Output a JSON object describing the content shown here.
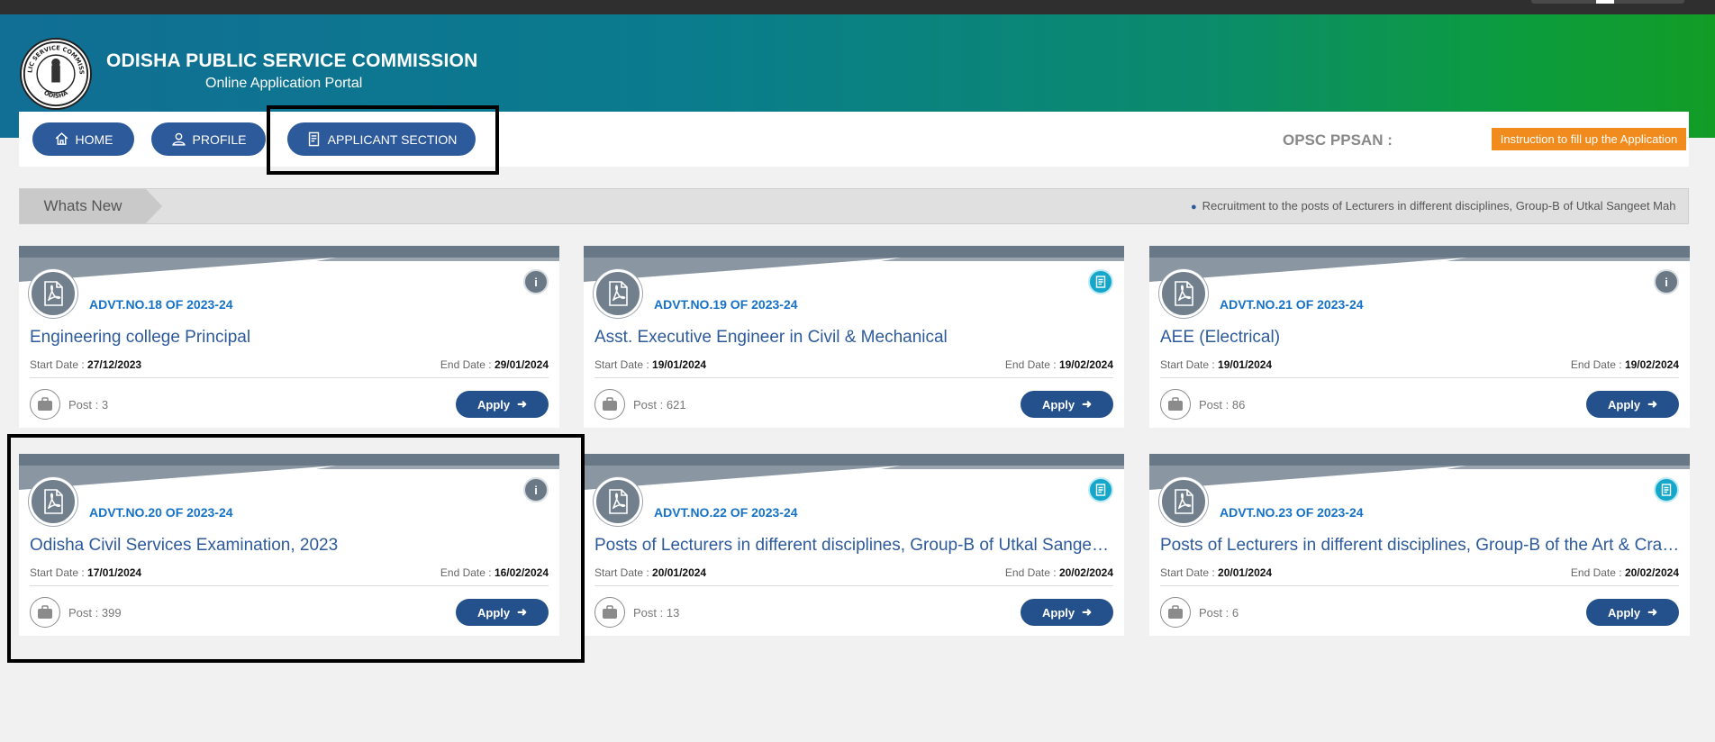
{
  "header": {
    "org_title": "ODISHA PUBLIC SERVICE COMMISSION",
    "org_subtitle": "Online Application Portal",
    "logo_text_top": "PUBLIC SERVICE COMMISSION",
    "logo_text_bottom": "ODISHA"
  },
  "nav": {
    "home": "HOME",
    "profile": "PROFILE",
    "applicant": "APPLICANT SECTION",
    "ppsan_label": "OPSC PPSAN :",
    "instruction_button": "Instruction to fill up the Application"
  },
  "whats_new": {
    "label": "Whats New",
    "ticker": "Recruitment to the posts of Lecturers in different disciplines, Group-B of Utkal Sangeet Mah"
  },
  "card_labels": {
    "start": "Start Date :",
    "end": "End Date :",
    "post": "Post :",
    "apply": "Apply"
  },
  "cards": [
    {
      "advt": "ADVT.NO.18 OF 2023-24",
      "title": "Engineering college Principal",
      "start": "27/12/2023",
      "end": "29/01/2024",
      "posts": "3",
      "icon": "info-icon"
    },
    {
      "advt": "ADVT.NO.19 OF 2023-24",
      "title": "Asst. Executive Engineer in Civil & Mechanical",
      "start": "19/01/2024",
      "end": "19/02/2024",
      "posts": "621",
      "icon": "document-icon"
    },
    {
      "advt": "ADVT.NO.21 OF 2023-24",
      "title": "AEE (Electrical)",
      "start": "19/01/2024",
      "end": "19/02/2024",
      "posts": "86",
      "icon": "info-icon"
    },
    {
      "advt": "ADVT.NO.20 OF 2023-24",
      "title": "Odisha Civil Services Examination, 2023",
      "start": "17/01/2024",
      "end": "16/02/2024",
      "posts": "399",
      "icon": "info-icon"
    },
    {
      "advt": "ADVT.NO.22 OF 2023-24",
      "title": "Posts of Lecturers in different disciplines, Group-B of Utkal Sangeet Mahavidyalaya",
      "start": "20/01/2024",
      "end": "20/02/2024",
      "posts": "13",
      "icon": "document-icon"
    },
    {
      "advt": "ADVT.NO.23 OF 2023-24",
      "title": "Posts of Lecturers in different disciplines, Group-B of the Art & Craft College",
      "start": "20/01/2024",
      "end": "20/02/2024",
      "posts": "6",
      "icon": "document-icon"
    }
  ],
  "colors": {
    "banner_start": "#116e94",
    "banner_end": "#129c26",
    "nav_button": "#2d5a9b",
    "apply_button": "#24508c",
    "instruction_button": "#f18b1e",
    "advt_text": "#1572c7"
  }
}
